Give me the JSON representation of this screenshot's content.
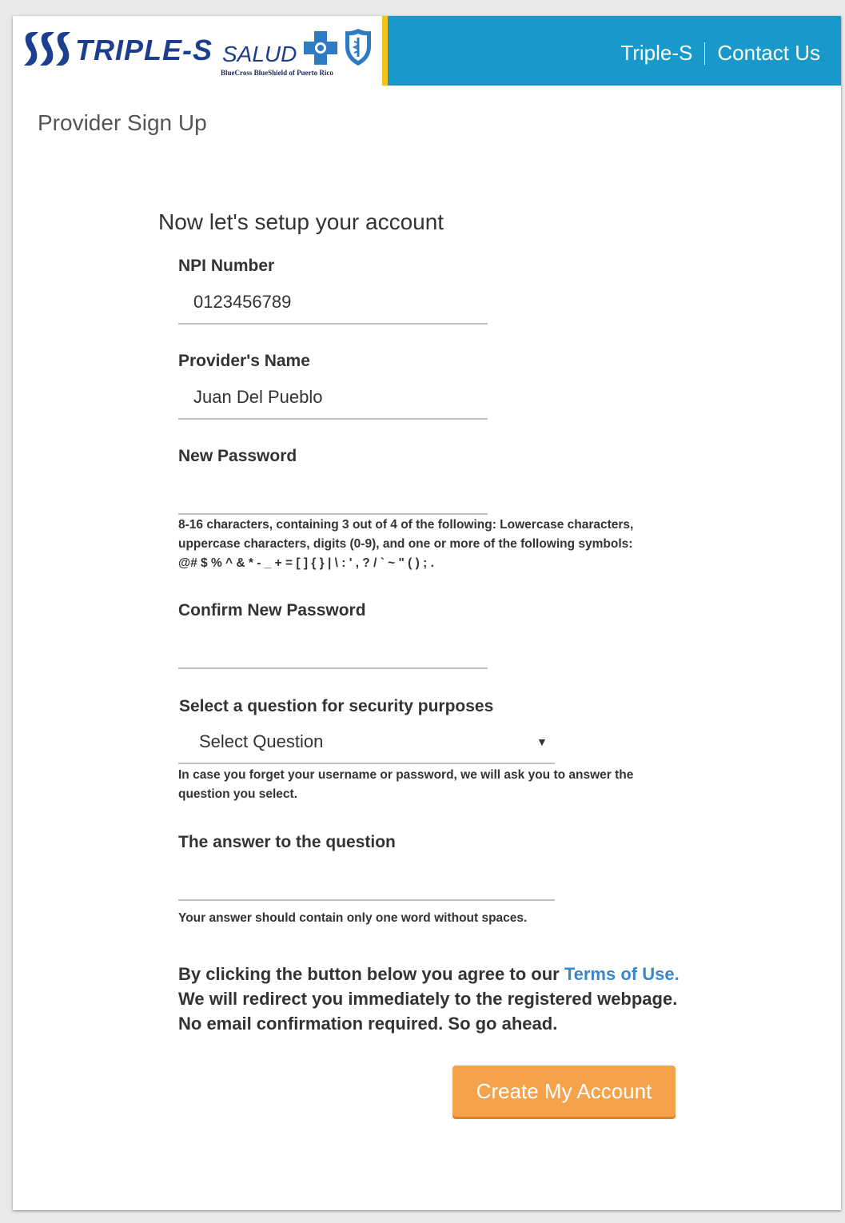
{
  "header": {
    "brand_name": "TRIPLE-S",
    "brand_salud": "SALUD",
    "brand_sub": "BlueCross BlueShield of Puerto Rico",
    "nav": [
      {
        "label": "Triple-S"
      },
      {
        "label": "Contact Us"
      }
    ]
  },
  "page_title": "Provider Sign Up",
  "form": {
    "title": "Now let's setup your account",
    "npi": {
      "label": "NPI Number",
      "value": "0123456789"
    },
    "provider_name": {
      "label": "Provider's Name",
      "value": "Juan Del Pueblo"
    },
    "new_password": {
      "label": "New Password",
      "value": "",
      "help_line1": "8-16 characters, containing 3 out of 4 of the following: Lowercase characters,",
      "help_line2": "uppercase characters, digits (0-9), and one or more of the following symbols:",
      "help_line3": "@# $ % ^ & * - _ + = [ ] { } | \\ : ' , ? / ` ~ \" ( ) ; ."
    },
    "confirm_password": {
      "label": "Confirm New Password",
      "value": ""
    },
    "security_question": {
      "label": "Select a question for security purposes",
      "selected": "Select Question",
      "help_line1": "In case you forget your username or password, we will ask you to answer the",
      "help_line2": "question you select."
    },
    "answer": {
      "label": "The answer to the question",
      "value": "",
      "help": "Your answer should contain only one word without spaces."
    },
    "agreement": {
      "line1_prefix": "By clicking the button below you agree to our ",
      "terms_link": "Terms of Use.",
      "line2": "We will redirect you immediately to the registered webpage.",
      "line3": "No email confirmation required. So go ahead."
    },
    "submit_label": "Create My Account"
  },
  "colors": {
    "header_blue": "#1899c9",
    "header_gold": "#f2c318",
    "brand_navy": "#1d3d8f",
    "button_orange": "#f5a24b",
    "link_blue": "#3a87c8"
  }
}
